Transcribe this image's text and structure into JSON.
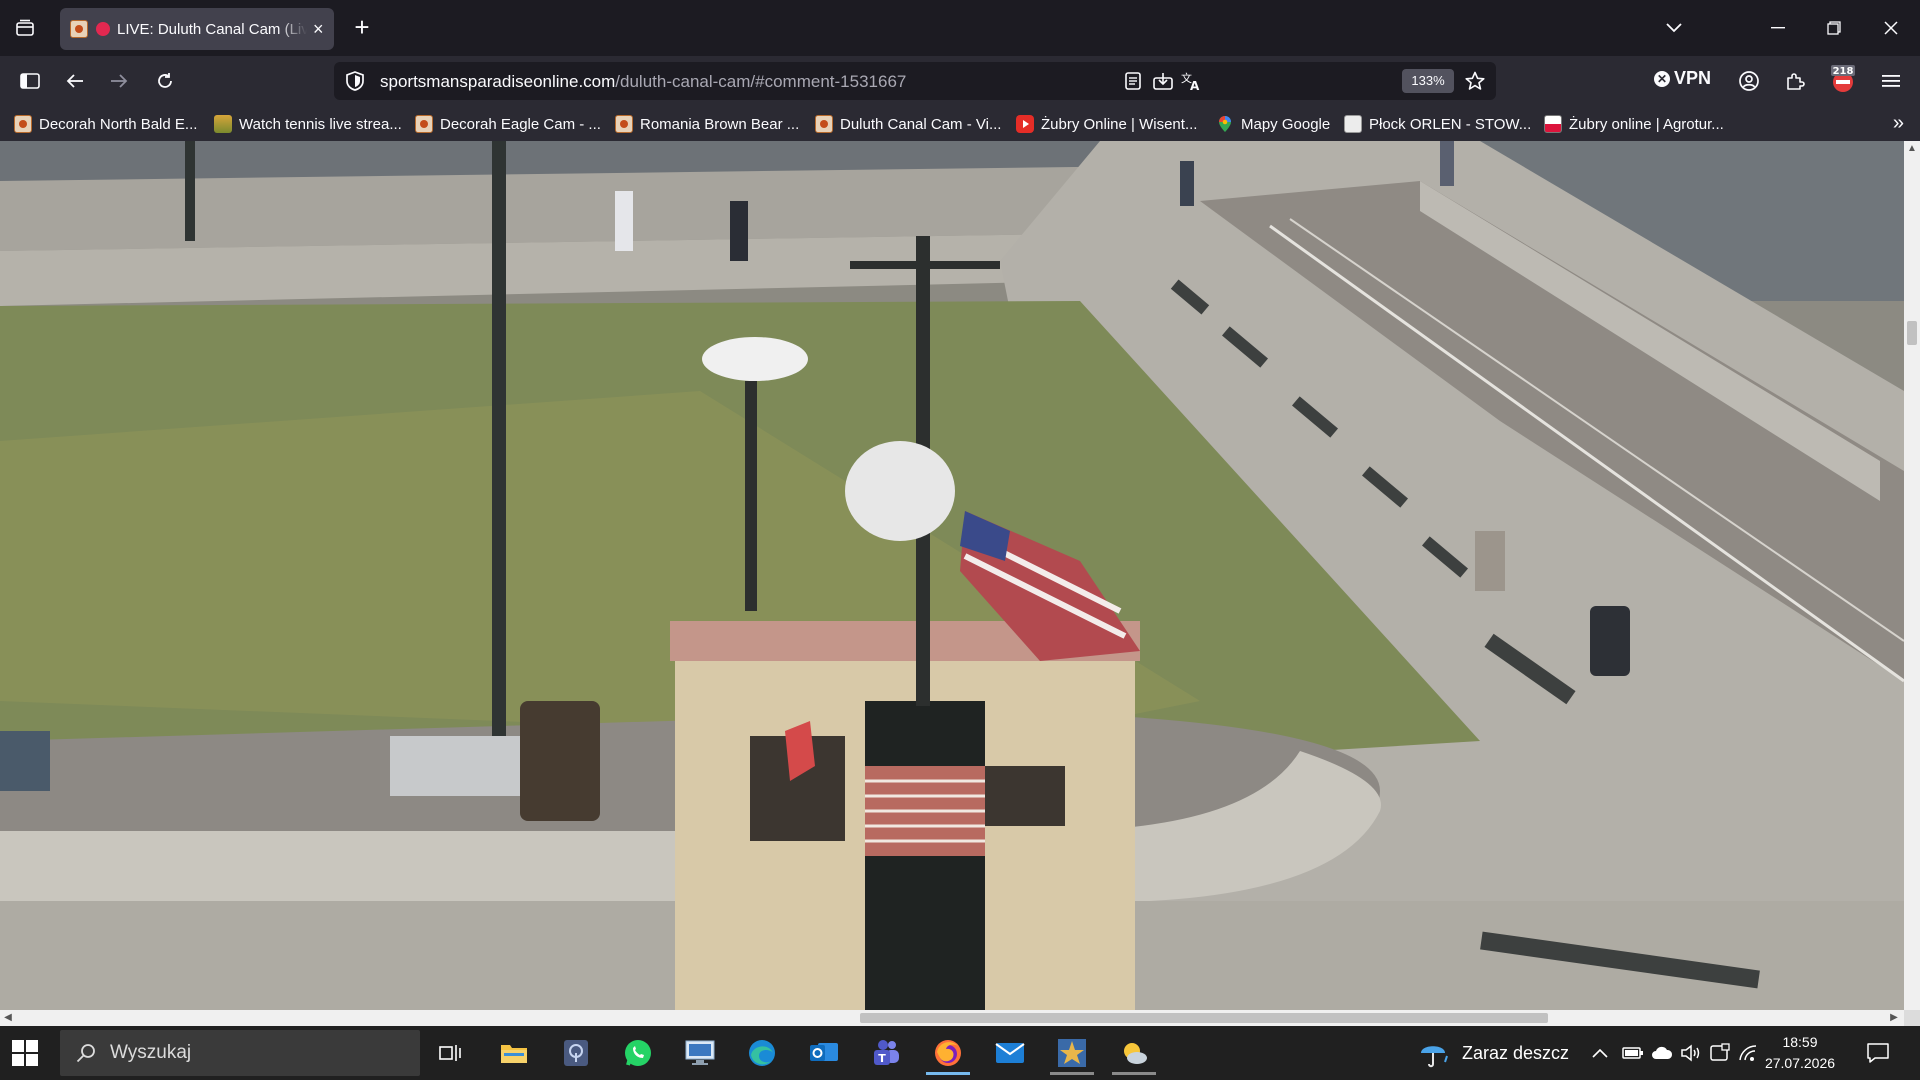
{
  "tab": {
    "title": "LIVE: Duluth Canal Cam (Live"
  },
  "window": {
    "close_tab": "×",
    "new_tab": "+"
  },
  "address": {
    "host": "sportsmansparadiseonline.com",
    "path": "/duluth-canal-cam/#comment-1531667",
    "zoom": "133%"
  },
  "vpn_label": "VPN",
  "extension_badge": "218",
  "bookmarks": [
    {
      "label": "Decorah North Bald E...",
      "icon": "eagle-cam-favicon"
    },
    {
      "label": "Watch tennis live strea...",
      "icon": "tennis-favicon"
    },
    {
      "label": "Decorah Eagle Cam - ...",
      "icon": "eagle-cam-favicon"
    },
    {
      "label": "Romania Brown Bear ...",
      "icon": "eagle-cam-favicon"
    },
    {
      "label": "Duluth Canal Cam - Vi...",
      "icon": "eagle-cam-favicon"
    },
    {
      "label": "Żubry Online | Wisent...",
      "icon": "youtube-favicon"
    },
    {
      "label": "Mapy Google",
      "icon": "google-maps-favicon"
    },
    {
      "label": "Płock ORLEN - STOW...",
      "icon": "orlen-favicon"
    },
    {
      "label": "Żubry online | Agrotur...",
      "icon": "poland-flag-favicon"
    }
  ],
  "taskbar": {
    "search_placeholder": "Wyszukaj",
    "weather": "Zaraz deszcz",
    "time": "18:59",
    "date": "27.07.2026",
    "apps": [
      "task-view",
      "file-explorer",
      "app-shield",
      "whatsapp",
      "remote-desktop",
      "edge",
      "outlook",
      "teams",
      "firefox",
      "mail",
      "photo-app",
      "weather-app"
    ]
  },
  "colors": {
    "tab_bg": "#42414d",
    "toolbar_bg": "#2b2a33",
    "urlbar_bg": "#1c1b22",
    "taskbar_bg": "#202020",
    "accent": "#76b9ed",
    "live_dot": "#e22850"
  }
}
